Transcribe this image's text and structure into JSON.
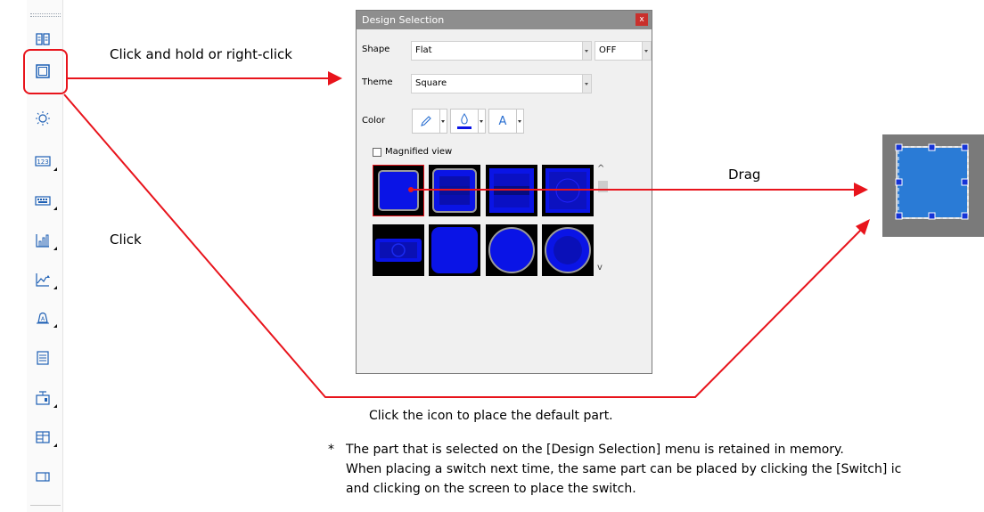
{
  "annotations": {
    "click_hold": "Click and hold or right-click",
    "click": "Click",
    "drag": "Drag",
    "default_part": "Click the icon to place the default part.",
    "note_star": "*",
    "note_line1": "The part that is selected on the [Design Selection] menu is retained in memory.",
    "note_line2": "When placing a switch next time, the same part can be placed by clicking the [Switch] ic",
    "note_line3": "and clicking on the screen to place the switch."
  },
  "dialog": {
    "title": "Design Selection",
    "close_label": "x",
    "shape_label": "Shape",
    "shape_value": "Flat",
    "state_value": "OFF",
    "theme_label": "Theme",
    "theme_value": "Square",
    "color_label": "Color",
    "text_color_glyph": "A",
    "magnified_label": "Magnified view",
    "scroll_up": "^",
    "scroll_down": "v"
  },
  "toolbar_icons": [
    "book-icon",
    "switch-icon",
    "lamp-icon",
    "numeric-display-icon",
    "keypad-icon",
    "bar-graph-icon",
    "trend-graph-icon",
    "alarm-icon",
    "memo-icon",
    "message-icon",
    "table-icon",
    "window-icon"
  ],
  "colors": {
    "accent_red": "#e8141c",
    "part_blue": "#0a14e6",
    "placed_blue": "#2a7bd6",
    "title_gray": "#8e8e8e"
  }
}
